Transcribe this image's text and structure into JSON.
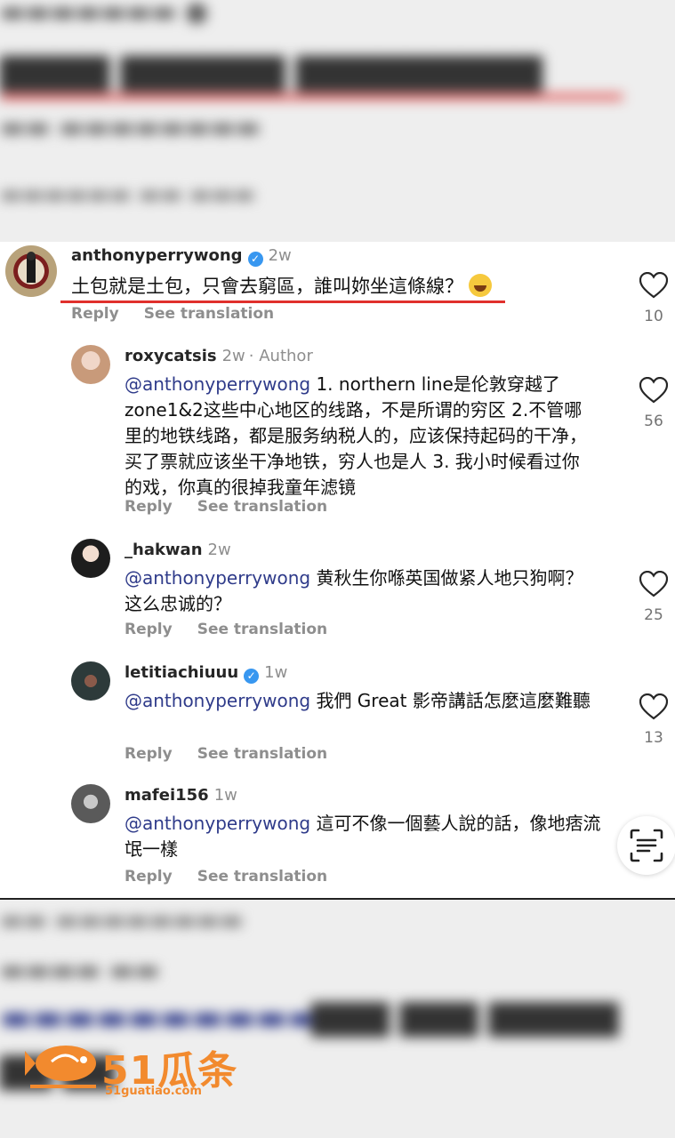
{
  "comments": [
    {
      "username": "anthonyperrywong",
      "verified": true,
      "time": "2w",
      "text": "土包就是土包，只會去窮區，誰叫妳坐這條線？",
      "reply_label": "Reply",
      "translate_label": "See translation",
      "likes": "10"
    },
    {
      "username": "roxycatsis",
      "time": "2w",
      "author_badge": "· Author",
      "mention": "@anthonyperrywong",
      "text": " 1. northern line是伦敦穿越了zone1&2这些中心地区的线路，不是所谓的穷区 2.不管哪里的地铁线路，都是服务纳税人的，应该保持起码的干净，买了票就应该坐干净地铁，穷人也是人 3. 我小时候看过你的戏，你真的很掉我童年滤镜",
      "reply_label": "Reply",
      "translate_label": "See translation",
      "likes": "56"
    },
    {
      "username": "_hakwan",
      "time": "2w",
      "mention": "@anthonyperrywong",
      "text": " 黄秋生你喺英国做紧人地只狗啊？这么忠诚的？",
      "reply_label": "Reply",
      "translate_label": "See translation",
      "likes": "25"
    },
    {
      "username": "letitiachiuuu",
      "verified": true,
      "time": "1w",
      "mention": "@anthonyperrywong",
      "text": " 我們 Great 影帝講話怎麼這麼難聽",
      "reply_label": "Reply",
      "translate_label": "See translation",
      "likes": "13"
    },
    {
      "username": "mafei156",
      "time": "1w",
      "mention": "@anthonyperrywong",
      "text": " 這可不像一個藝人說的話，像地痞流氓一樣",
      "reply_label": "Reply",
      "translate_label": "See translation"
    }
  ],
  "icons": {
    "like": "heart-outline-icon",
    "verified": "verified-badge-icon",
    "scan": "text-scan-icon"
  },
  "watermark": {
    "brand": "51瓜条",
    "url": "51guatiao.com"
  },
  "colors": {
    "mention": "#2f3b8a",
    "verified": "#3897f0",
    "underline": "#e0302c",
    "watermark": "#f28a2e"
  }
}
